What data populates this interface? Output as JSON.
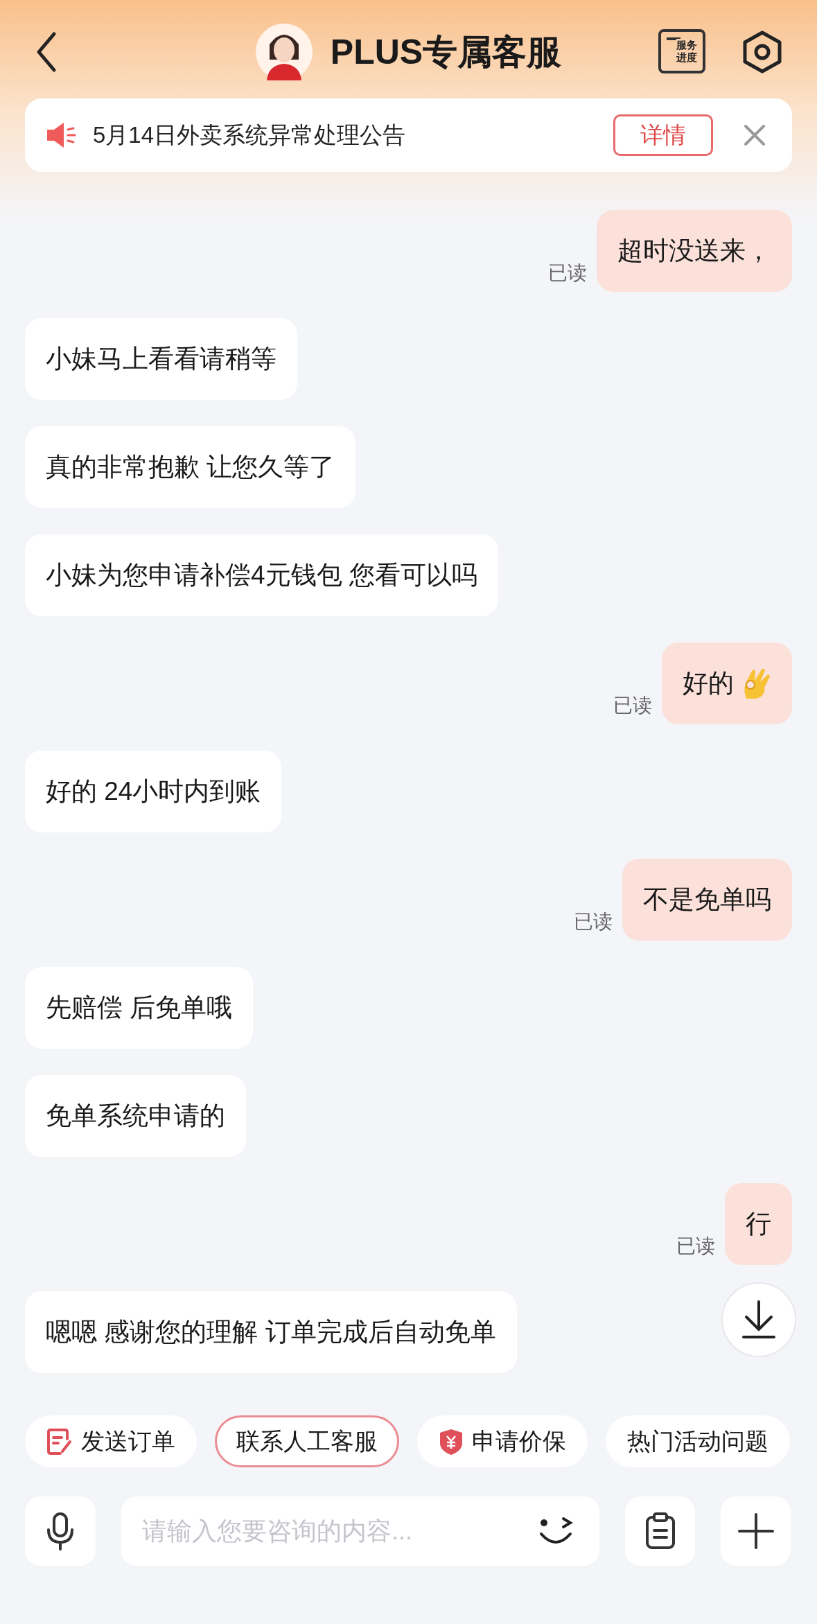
{
  "header": {
    "title": "PLUS专属客服",
    "progress_icon_lines": [
      "服务",
      "进度"
    ]
  },
  "notice": {
    "text": "5月14日外卖系统异常处理公告",
    "button": "详情"
  },
  "messages": [
    {
      "kind": "outgoing",
      "text": "超时没送来，",
      "receipt": "已读"
    },
    {
      "kind": "incoming",
      "text": "小妹马上看看请稍等"
    },
    {
      "kind": "incoming",
      "text": "真的非常抱歉 让您久等了"
    },
    {
      "kind": "incoming",
      "text": "小妹为您申请补偿4元钱包 您看可以吗"
    },
    {
      "kind": "outgoing-with-gesture",
      "text": "好的",
      "receipt": "已读"
    },
    {
      "kind": "incoming",
      "text": "好的 24小时内到账"
    },
    {
      "kind": "outgoing",
      "text": "不是免单吗",
      "receipt": "已读"
    },
    {
      "kind": "incoming",
      "text": "先赔偿 后免单哦"
    },
    {
      "kind": "incoming",
      "text": "免单系统申请的"
    },
    {
      "kind": "outgoing",
      "text": "行",
      "receipt": "已读"
    },
    {
      "kind": "incoming",
      "text": "嗯嗯 感谢您的理解 订单完成后自动免单"
    }
  ],
  "quick_actions": [
    {
      "kind": "order",
      "label": "发送订单",
      "highlighted": false
    },
    {
      "kind": "plain",
      "label": "联系人工客服",
      "highlighted": true
    },
    {
      "kind": "shield",
      "label": "申请价保",
      "highlighted": false
    },
    {
      "kind": "plain",
      "label": "热门活动问题",
      "highlighted": false
    }
  ],
  "input": {
    "placeholder": "请输入您要咨询的内容..."
  }
}
